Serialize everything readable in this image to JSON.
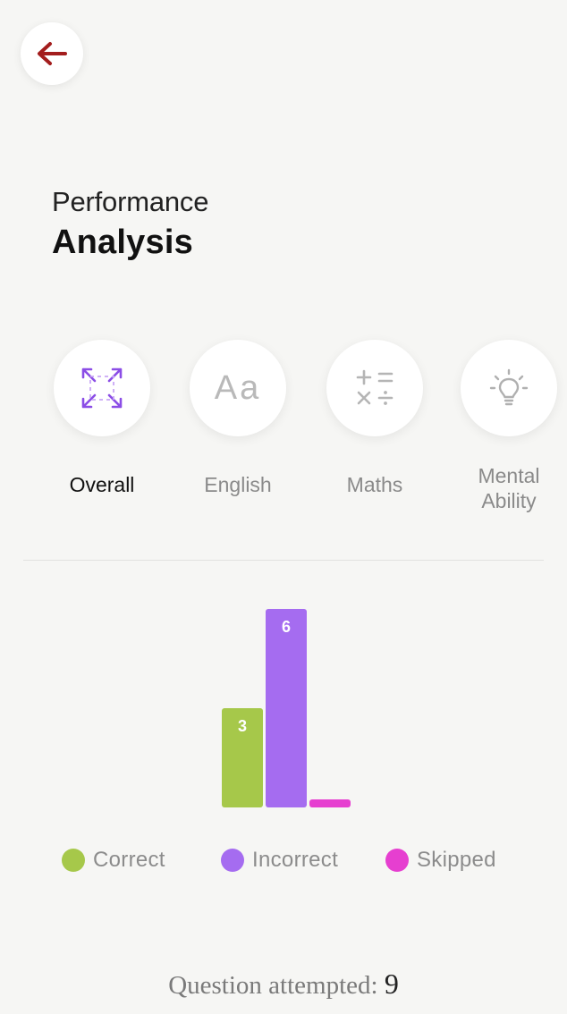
{
  "header": {
    "back_icon": "arrow-left-icon",
    "back_color": "#a31d1d"
  },
  "title": {
    "line1": "Performance",
    "line2": "Analysis"
  },
  "tabs": [
    {
      "label": "Overall",
      "icon": "expand-arrows-icon",
      "active": true
    },
    {
      "label": "English",
      "icon": "text-aa-icon",
      "icon_text": "Aa",
      "active": false
    },
    {
      "label": "Maths",
      "icon": "math-operators-icon",
      "active": false
    },
    {
      "label": "Mental\nAbility",
      "icon": "lightbulb-icon",
      "active": false
    }
  ],
  "chart_data": {
    "type": "bar",
    "categories": [
      "Correct",
      "Incorrect",
      "Skipped"
    ],
    "values": [
      3,
      6,
      0
    ],
    "data_labels": [
      "3",
      "6",
      ""
    ],
    "colors": [
      "#a6c84a",
      "#a56cf0",
      "#e63fd0"
    ],
    "ylim": [
      0,
      6
    ],
    "grid": false,
    "legend_position": "bottom"
  },
  "legend": [
    {
      "label": "Correct",
      "color": "#a6c84a"
    },
    {
      "label": "Incorrect",
      "color": "#a56cf0"
    },
    {
      "label": "Skipped",
      "color": "#e63fd0"
    }
  ],
  "footer": {
    "attempted_label": "Question attempted:",
    "attempted_count": "9"
  }
}
